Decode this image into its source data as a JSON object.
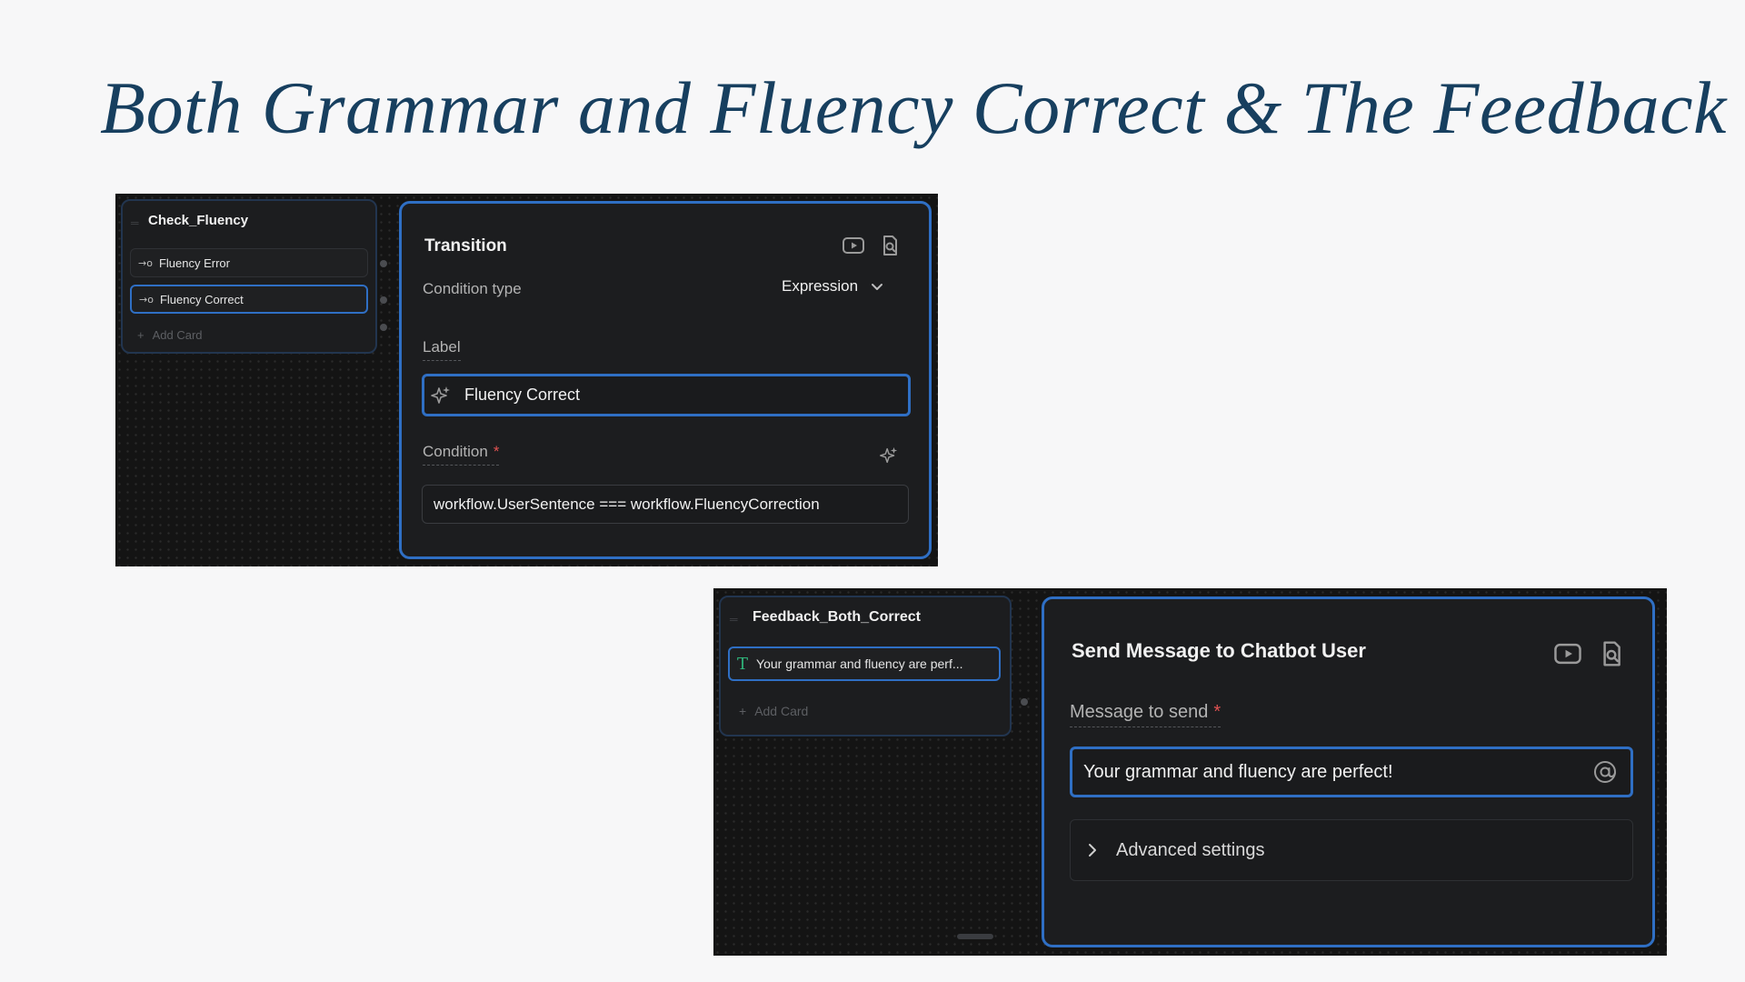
{
  "slide": {
    "title": "Both Grammar and Fluency Correct & The Feedback"
  },
  "transition_screenshot": {
    "node": {
      "title": "Check_Fluency",
      "rows": [
        {
          "icon": "→o",
          "label": "Fluency Error",
          "selected": false
        },
        {
          "icon": "→o",
          "label": "Fluency Correct",
          "selected": true
        }
      ],
      "add_card": "Add Card"
    },
    "panel": {
      "title": "Transition",
      "condition_type_label": "Condition type",
      "condition_type_value": "Expression",
      "label_label": "Label",
      "label_value": "Fluency Correct",
      "condition_label": "Condition",
      "condition_required": "*",
      "condition_value": "workflow.UserSentence === workflow.FluencyCorrection"
    }
  },
  "message_screenshot": {
    "node": {
      "title": "Feedback_Both_Correct",
      "rows": [
        {
          "icon": "T",
          "label": "Your grammar and fluency are perf...",
          "selected": true
        }
      ],
      "add_card": "Add Card"
    },
    "panel": {
      "title": "Send Message to Chatbot User",
      "message_label": "Message to send",
      "message_required": "*",
      "message_value": "Your grammar and fluency are perfect!",
      "advanced_settings": "Advanced settings"
    }
  },
  "colors": {
    "title": "#173f5f",
    "accent_border": "#2f6fc4",
    "text_icon_green": "#2fb37a",
    "required": "#e05252"
  },
  "icons": [
    "play-video-icon",
    "search-doc-icon",
    "sparkle-icon",
    "chevron-down-icon",
    "chevron-right-icon",
    "at-sign-icon",
    "text-t-icon",
    "transition-arrow-icon",
    "drag-grip-icon",
    "plus-icon"
  ]
}
